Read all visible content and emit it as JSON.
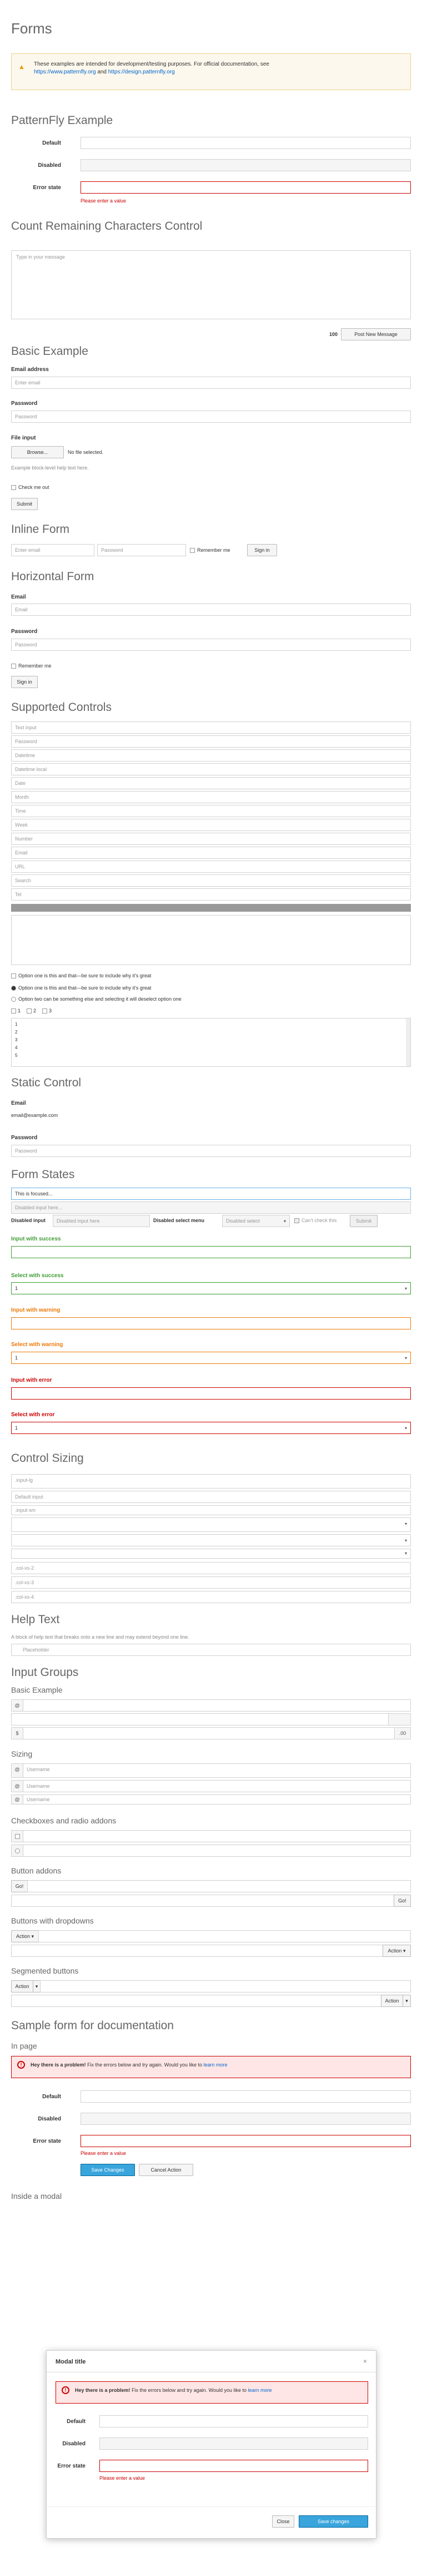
{
  "page_title": "Forms",
  "warning": {
    "text": "These examples are intended for development/testing purposes. For official documentation, see",
    "link1": "https://www.patternfly.org",
    "mid": "and",
    "link2": "https://design.patternfly.org"
  },
  "patternfly_example": {
    "title": "PatternFly Example",
    "labels": [
      "Default",
      "Disabled",
      "Error state"
    ],
    "error_help": "Please enter a value"
  },
  "count_remaining": {
    "title": "Count Remaining Characters Control",
    "placeholder": "Type in your message",
    "count": "100",
    "post_button": "Post New Message"
  },
  "basic_example": {
    "title": "Basic Example",
    "email_label": "Email address",
    "email_placeholder": "Enter email",
    "password_label": "Password",
    "password_placeholder": "Password",
    "file_label": "File input",
    "browse": "Browse...",
    "no_file": "No file selected.",
    "file_help": "Example block-level help text here.",
    "checkout": "Check me out",
    "submit": "Submit"
  },
  "inline_form": {
    "title": "Inline Form",
    "email_placeholder": "Enter email",
    "password_placeholder": "Password",
    "remember": "Remember me",
    "signin": "Sign in"
  },
  "horizontal_form": {
    "title": "Horizontal Form",
    "email_label": "Email",
    "email_placeholder": "Email",
    "password_label": "Password",
    "password_placeholder": "Password",
    "remember": "Remember me",
    "signin": "Sign in"
  },
  "supported_controls": {
    "title": "Supported Controls",
    "inputs": [
      "Text input",
      "Password",
      "Datetime",
      "Datetime local",
      "Date",
      "Month",
      "Time",
      "Week",
      "Number",
      "Email",
      "URL",
      "Search",
      "Tel"
    ],
    "checkbox1": "Option one is this and that—be sure to include why it's great",
    "radio1": "Option one is this and that—be sure to include why it's great",
    "radio2": "Option two can be something else and selecting it will deselect option one",
    "inline_checks": [
      "1",
      "2",
      "3"
    ],
    "multi_options": [
      "1",
      "2",
      "3",
      "4",
      "5"
    ]
  },
  "static_control": {
    "title": "Static Control",
    "email_label": "Email",
    "email_value": "email@example.com",
    "password_label": "Password",
    "password_placeholder": "Password"
  },
  "form_states": {
    "title": "Form States",
    "focused_value": "This is focused...",
    "disabled_placeholder": "Disabled input here...",
    "disabled_input_label": "Disabled input",
    "disabled_input_placeholder": "Disabled input here",
    "disabled_select_label": "Disabled select menu",
    "disabled_select_value": "Disabled select",
    "cant_check": "Can't check this",
    "submit": "Submit",
    "success_input": "Input with success",
    "success_select": "Select with success",
    "warning_input": "Input with warning",
    "warning_select": "Select with warning",
    "error_input": "Input with error",
    "error_select": "Select with error",
    "select_value": "1"
  },
  "control_sizing": {
    "title": "Control Sizing",
    "inputs": [
      ".input-lg",
      "Default input",
      ".input-sm"
    ],
    "selects": [
      ".col-xs-2",
      ".col-xs-3",
      ".col-xs-4"
    ]
  },
  "help_text": {
    "title": "Help Text",
    "text": "A block of help text that breaks onto a new line and may extend beyond one line.",
    "placeholder": "Placeholder"
  },
  "input_groups": {
    "title": "Input Groups",
    "basic_title": "Basic Example",
    "at": "@",
    "dollar": "$",
    "cents": ".00",
    "sizing_title": "Sizing",
    "username": "Username",
    "check_radio_title": "Checkboxes and radio addons",
    "button_addons_title": "Button addons",
    "go": "Go!",
    "dropdown_title": "Buttons with dropdowns",
    "action": "Action",
    "segmented_title": "Segmented buttons"
  },
  "sample_form": {
    "title": "Sample form for documentation",
    "in_page": "In page",
    "alert_bold": "Hey there is a problem!",
    "alert_text": "Fix the errors below and try again. Would you like to",
    "alert_link": "learn more",
    "labels": [
      "Default",
      "Disabled",
      "Error state"
    ],
    "error_help": "Please enter a value",
    "save": "Save Changes",
    "cancel": "Cancel Action"
  },
  "modal": {
    "section_title": "Inside a modal",
    "title": "Modal title",
    "alert_bold": "Hey there is a problem!",
    "alert_text": "Fix the errors below and try again. Would you like to",
    "alert_link": "learn more",
    "labels": [
      "Default",
      "Disabled",
      "Error state"
    ],
    "error_help": "Please enter a value",
    "close": "Close",
    "save": "Save changes"
  }
}
